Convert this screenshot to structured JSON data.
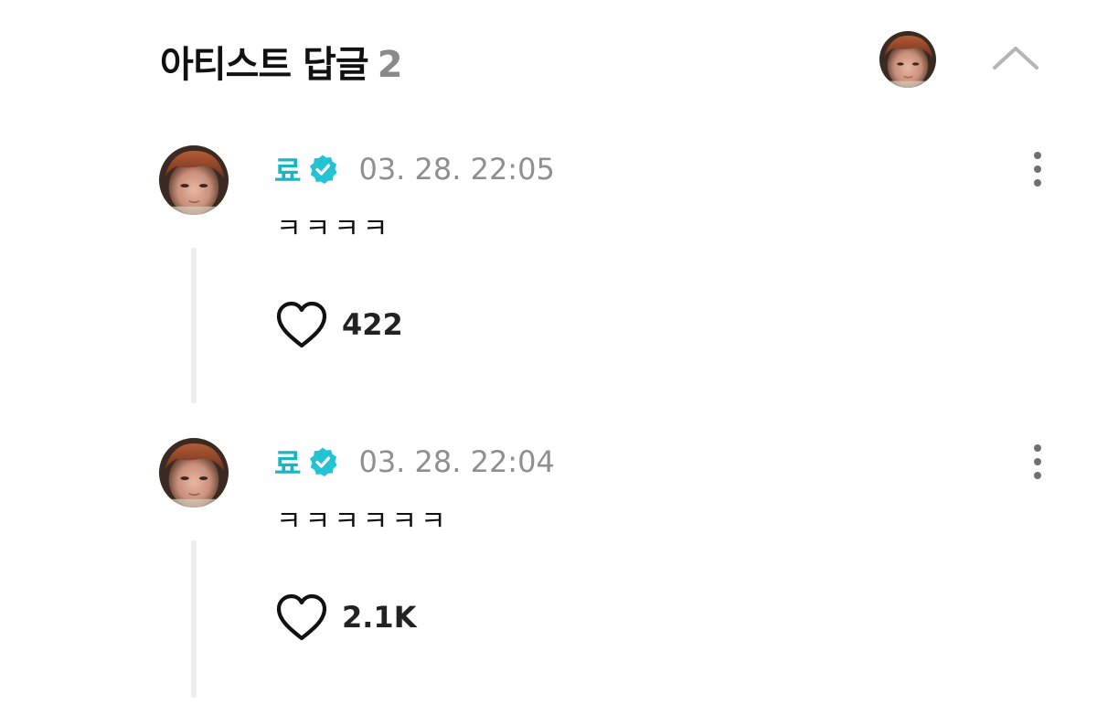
{
  "header": {
    "title": "아티스트 답글",
    "count": "2",
    "collapse_icon": "chevron-up-icon",
    "avatar_icon": "profile-photo"
  },
  "replies": [
    {
      "author": "료",
      "verified_icon": "verified-badge-icon",
      "time": "03. 28. 22:05",
      "text": "ㅋㅋㅋㅋ",
      "likes": "422",
      "like_icon": "heart-outline-icon",
      "more_icon": "more-vertical-icon"
    },
    {
      "author": "료",
      "verified_icon": "verified-badge-icon",
      "time": "03. 28. 22:04",
      "text": "ㅋㅋㅋㅋㅋㅋ",
      "likes": "2.1K",
      "like_icon": "heart-outline-icon",
      "more_icon": "more-vertical-icon"
    }
  ],
  "colors": {
    "author": "#18b6c4",
    "verified": "#22c4d4",
    "muted": "#8f8f8f",
    "thread_line": "#eeeeee"
  }
}
